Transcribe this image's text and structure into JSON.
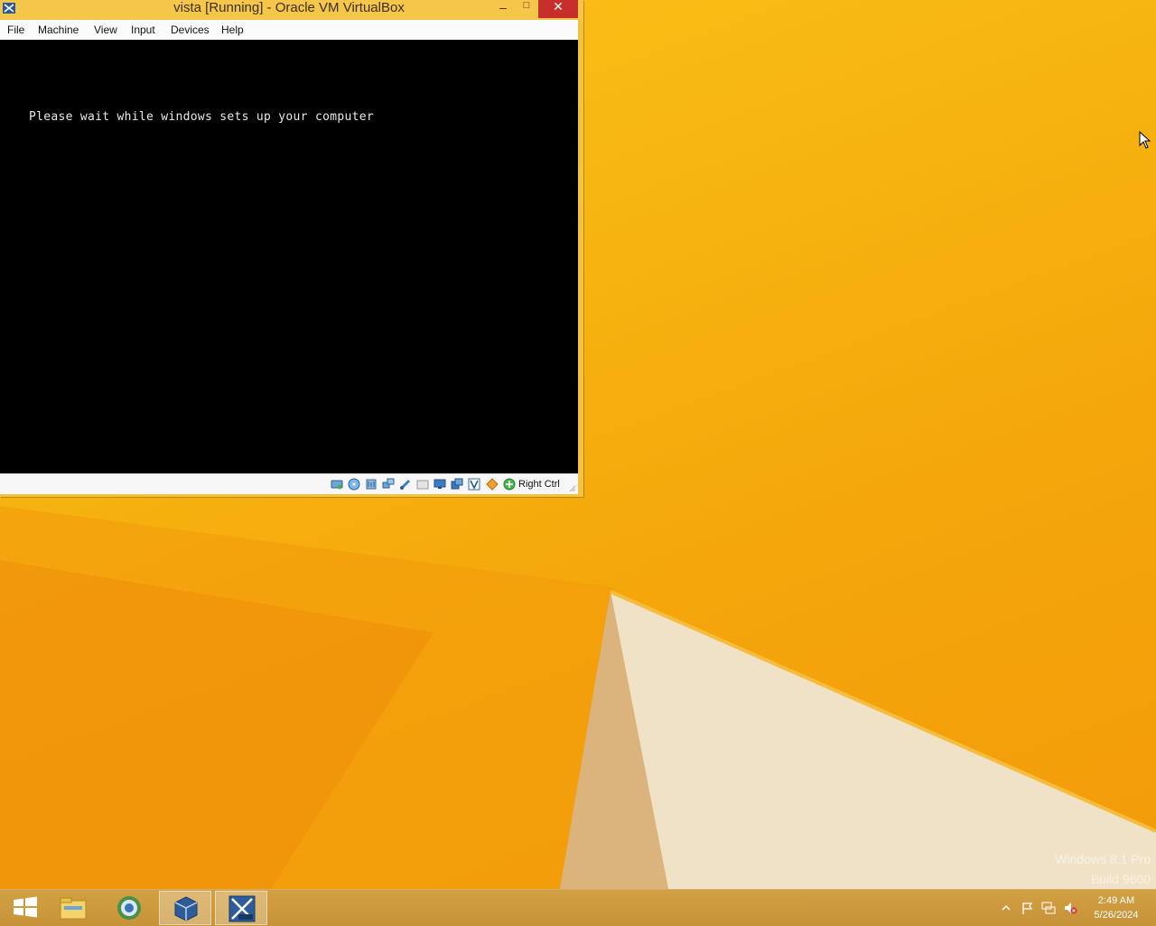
{
  "window": {
    "title": "vista [Running] - Oracle VM VirtualBox",
    "minimize_glyph": "–",
    "maximize_glyph": "□",
    "close_glyph": "✕"
  },
  "menu": {
    "items": [
      "File",
      "Machine",
      "View",
      "Input",
      "Devices",
      "Help"
    ]
  },
  "vm": {
    "message": "Please wait while windows sets up your computer"
  },
  "statusbar": {
    "icons": [
      "hard-disk-icon",
      "optical-drive-icon",
      "audio-icon",
      "network-icon",
      "usb-icon",
      "shared-folders-icon",
      "display-icon",
      "video-capture-icon",
      "virtualization-icon",
      "mouse-integration-icon",
      "keyboard-capture-icon"
    ],
    "host_key": "Right Ctrl"
  },
  "watermark": {
    "edition": "Windows 8.1 Pro",
    "build": "Build 9600"
  },
  "taskbar": {
    "buttons": [
      "start-button",
      "file-explorer",
      "browser",
      "virtualbox-manager",
      "vista-vm"
    ],
    "tray_icons": [
      "show-hidden-icons",
      "action-center-flag-icon",
      "network-icon",
      "volume-muted-icon"
    ],
    "time": "2:49 AM",
    "date": "5/26/2024"
  },
  "colors": {
    "wallpaper": "#f6b300",
    "titlebar": "#f5c649",
    "close": "#c7302a",
    "vm_screen": "#000000"
  }
}
